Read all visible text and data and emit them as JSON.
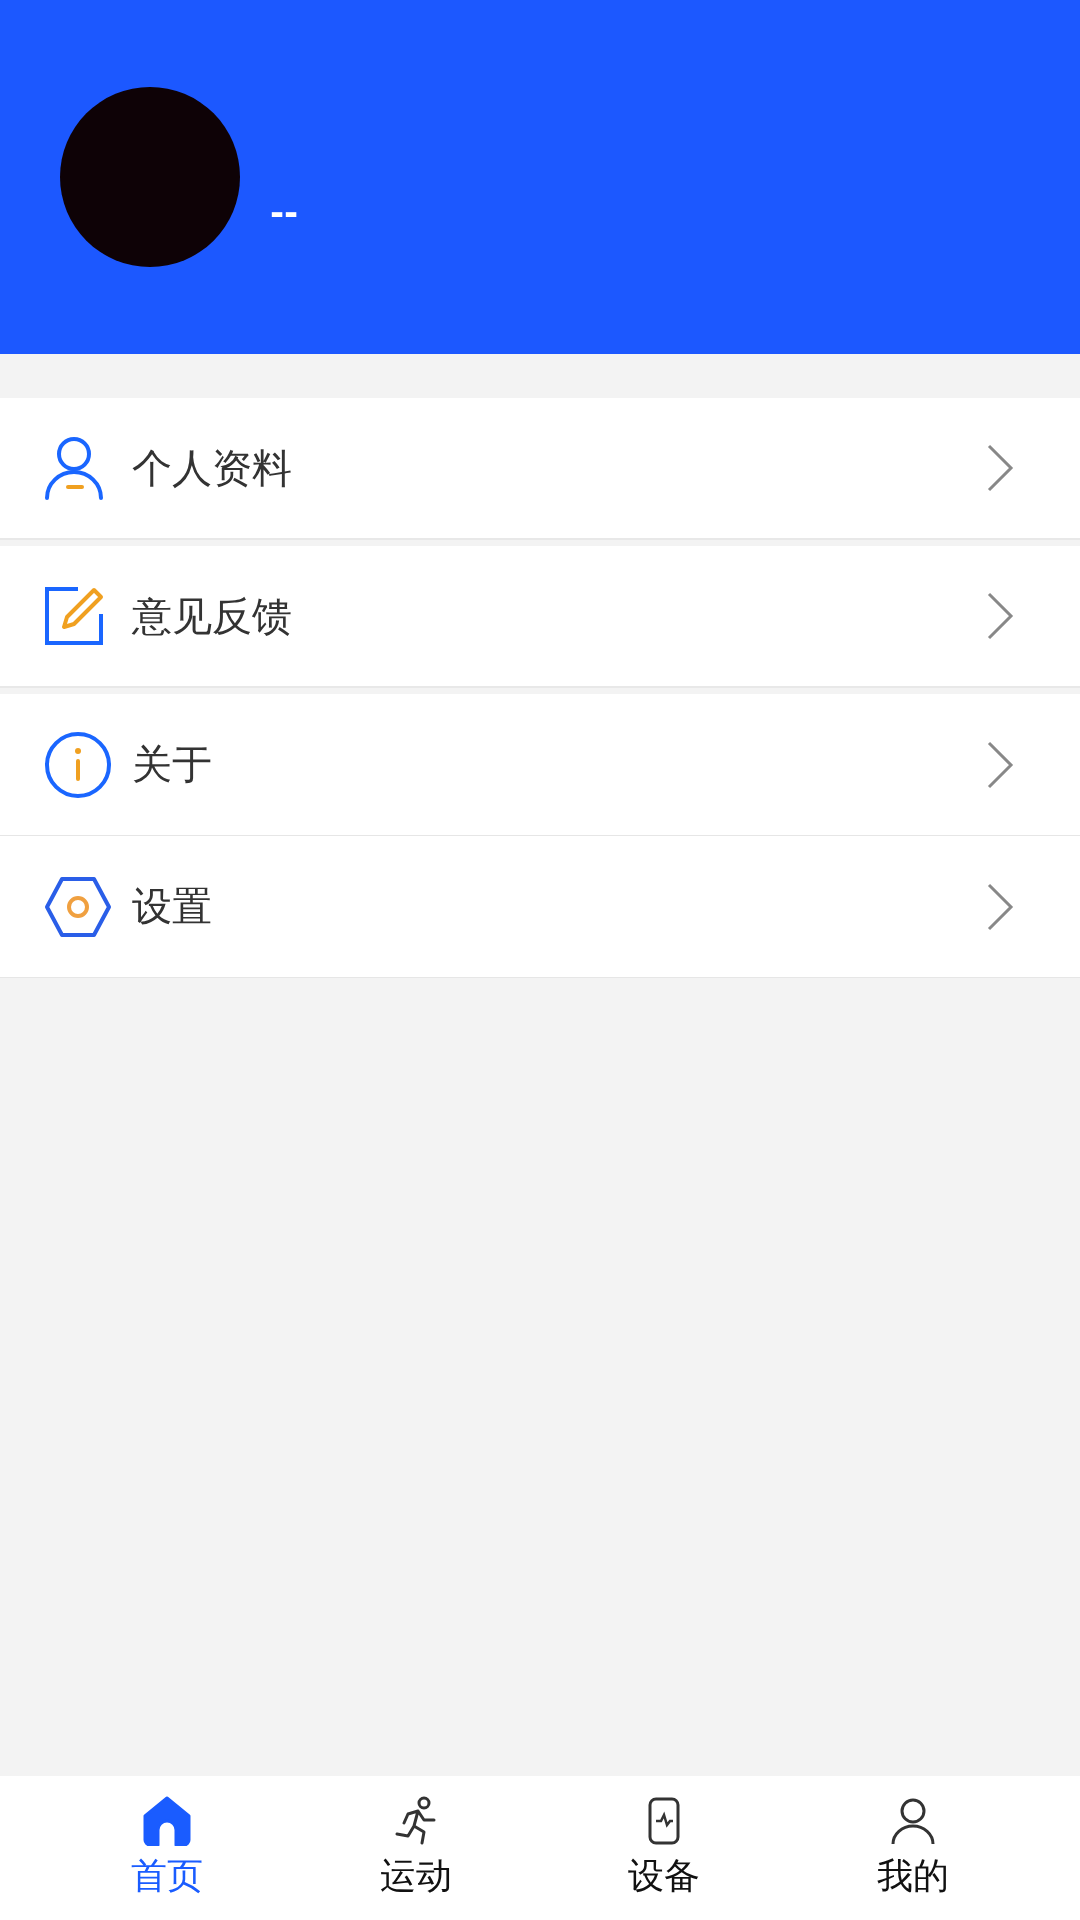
{
  "profile": {
    "name": "--"
  },
  "menu": [
    {
      "kind": "profile",
      "label": "个人资料",
      "gap_after": true
    },
    {
      "kind": "feedback",
      "label": "意见反馈",
      "gap_after": true
    },
    {
      "kind": "about",
      "label": "关于",
      "gap_after": false
    },
    {
      "kind": "settings",
      "label": "设置",
      "gap_after": false
    }
  ],
  "tabs": [
    {
      "kind": "home",
      "label": "首页",
      "selected": true
    },
    {
      "kind": "sport",
      "label": "运动",
      "selected": false
    },
    {
      "kind": "device",
      "label": "设备",
      "selected": false
    },
    {
      "kind": "mine",
      "label": "我的",
      "selected": false
    }
  ]
}
